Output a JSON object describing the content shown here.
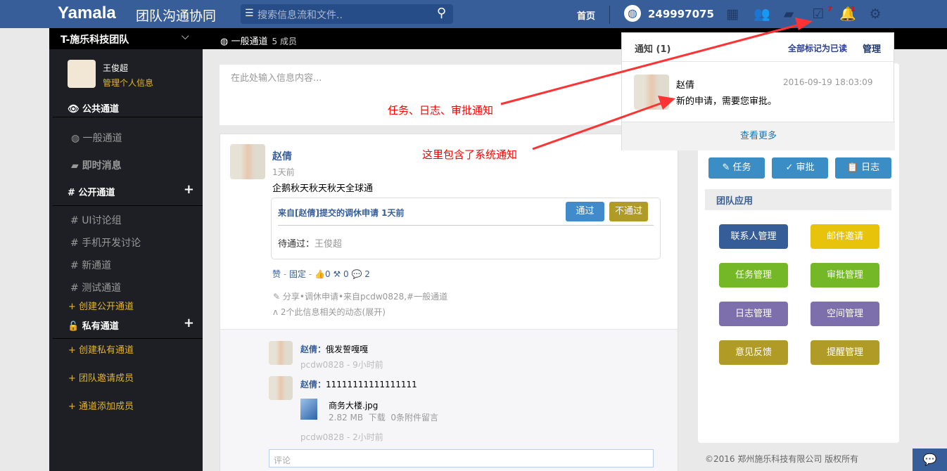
{
  "header": {
    "logo": "Yamala",
    "subtitle": "团队沟通协同",
    "search_placeholder": "搜索信息流和文件..",
    "home": "首页",
    "team_id": "249997075",
    "task_badge": "7",
    "bell_badge": "1"
  },
  "subbar": {
    "team": "T-施乐科技团队",
    "channel": "一般通道",
    "members": "5 成员"
  },
  "user": {
    "name": "王俊超",
    "manage": "管理个人信息"
  },
  "sidebar": {
    "public_head": "公共通道",
    "general": "一般通道",
    "im": "即时消息",
    "open_head": "公开通道",
    "open_channels": [
      "UI讨论组",
      "手机开发讨论",
      "新通道",
      "测试通道"
    ],
    "create_open": "+ 创建公开通道",
    "private_head": "私有通道",
    "create_private": "+ 创建私有通道",
    "invite": "+ 团队邀请成员",
    "add_member": "+ 通道添加成员"
  },
  "compose": {
    "placeholder": "在此处输入信息内容..."
  },
  "post": {
    "author": "赵倩",
    "time": "1天前",
    "text": "企鹅秋天秋天秋天全球通",
    "approval_title": "来自[赵倩]提交的调休申请 1天前",
    "approve": "通过",
    "reject": "不通过",
    "pending_label": "待通过：",
    "pending_user": "王俊超",
    "like": "赞",
    "pin": "固定",
    "sep": "-",
    "likes": "0",
    "tools": "0",
    "comments": "2",
    "share": "分享•调休申请•来自pcdw0828,#一般通道",
    "related": "2个此信息相关的动态(展开)"
  },
  "comments": [
    {
      "author": "赵倩：",
      "text": "俄发誓嘎嘎",
      "meta": "pcdw0828 - 9小时前"
    },
    {
      "author": "赵倩：",
      "text": "11111111111111111",
      "file": "商务大楼.jpg",
      "size": "2.82 MB",
      "download": "下载",
      "notes": "0条附件留言",
      "meta": "pcdw0828 - 2小时前"
    }
  ],
  "comment_placeholder": "评论",
  "notification": {
    "title": "通知 (1)",
    "mark_all": "全部标记为已读",
    "manage": "管理",
    "sender": "赵倩",
    "time": "2016-09-19 18:03:09",
    "message": "新的申请，需要您审批。",
    "more": "查看更多"
  },
  "right": {
    "quick": [
      "任务",
      "审批",
      "日志"
    ],
    "apps_head": "团队应用",
    "apps": [
      {
        "label": "联系人管理",
        "color": "#375d98"
      },
      {
        "label": "邮件邀请",
        "color": "#e8c30c"
      },
      {
        "label": "任务管理",
        "color": "#74b827"
      },
      {
        "label": "审批管理",
        "color": "#74b827"
      },
      {
        "label": "日志管理",
        "color": "#7d6fab"
      },
      {
        "label": "空间管理",
        "color": "#7d6fab"
      },
      {
        "label": "意见反馈",
        "color": "#b09b26"
      },
      {
        "label": "提醒管理",
        "color": "#b09b26"
      }
    ]
  },
  "footer": "©2016 郑州施乐科技有限公司 版权所有",
  "annotations": {
    "a1": "任务、日志、审批通知",
    "a2": "这里包含了系统通知"
  }
}
